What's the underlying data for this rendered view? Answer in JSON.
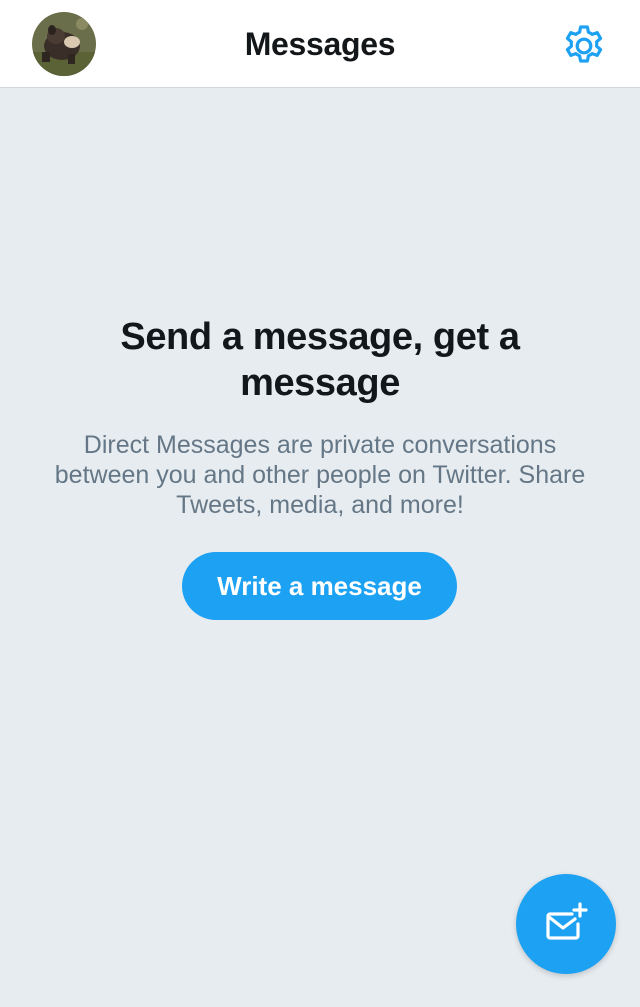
{
  "header": {
    "title": "Messages",
    "avatar_icon": "user-avatar-photo",
    "settings_icon": "gear-icon"
  },
  "empty_state": {
    "title": "Send a message, get a message",
    "body": "Direct Messages are private conversations between you and other people on Twitter. Share Tweets, media, and more!",
    "button_label": "Write a message"
  },
  "fab": {
    "icon": "new-message-icon"
  },
  "colors": {
    "accent": "#1da1f2",
    "background": "#e6ecf0",
    "text_primary": "#14171a",
    "text_secondary": "#657786"
  }
}
